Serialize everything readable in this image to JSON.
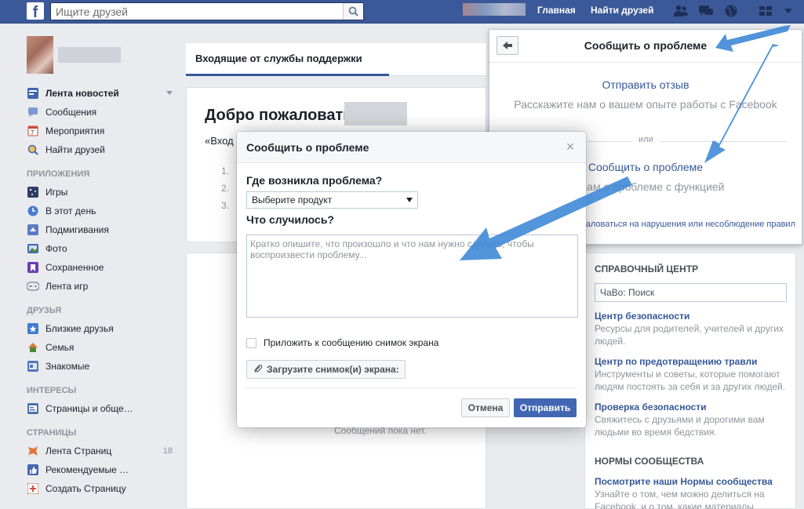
{
  "topbar": {
    "logo": "f",
    "search_placeholder": "Ищите друзей",
    "nav_home": "Главная",
    "nav_find_friends": "Найти друзей"
  },
  "sidebar": {
    "items_top": [
      {
        "label": "Лента новостей",
        "icon": "news-feed-icon"
      },
      {
        "label": "Сообщения",
        "icon": "messages-icon"
      },
      {
        "label": "Мероприятия",
        "icon": "events-icon"
      },
      {
        "label": "Найти друзей",
        "icon": "find-friends-icon"
      }
    ],
    "heading_apps": "ПРИЛОЖЕНИЯ",
    "items_apps": [
      {
        "label": "Игры",
        "icon": "games-icon"
      },
      {
        "label": "В этот день",
        "icon": "on-this-day-icon"
      },
      {
        "label": "Подмигивания",
        "icon": "pokes-icon"
      },
      {
        "label": "Фото",
        "icon": "photos-icon"
      },
      {
        "label": "Сохраненное",
        "icon": "saved-icon"
      },
      {
        "label": "Лента игр",
        "icon": "games-feed-icon"
      }
    ],
    "heading_friends": "ДРУЗЬЯ",
    "items_friends": [
      {
        "label": "Близкие друзья",
        "icon": "close-friends-icon"
      },
      {
        "label": "Семья",
        "icon": "family-icon"
      },
      {
        "label": "Знакомые",
        "icon": "acquaintances-icon"
      }
    ],
    "heading_interests": "ИНТЕРЕСЫ",
    "items_interests": [
      {
        "label": "Страницы и обще…",
        "icon": "pages-icon"
      }
    ],
    "heading_pages": "СТРАНИЦЫ",
    "items_pages": [
      {
        "label": "Лента Страниц",
        "icon": "pages-feed-icon",
        "count": "18"
      },
      {
        "label": "Рекомендуемые …",
        "icon": "like-icon"
      },
      {
        "label": "Создать Страницу",
        "icon": "create-page-icon"
      }
    ]
  },
  "main": {
    "tab_label": "Входящие от службы поддержки",
    "welcome_title": "Добро пожаловать,",
    "welcome_quote": "«Вход",
    "welcome_numbers": [
      "1.",
      "2.",
      "3."
    ],
    "no_messages": "Сообщений пока нет."
  },
  "help": {
    "heading": "СПРАВОЧНЫЙ ЦЕНТР",
    "search_placeholder": "ЧаВо: Поиск",
    "links": [
      {
        "title": "Центр безопасности",
        "desc": "Ресурсы для родителей, учителей и других людей."
      },
      {
        "title": "Центр по предотвращению травли",
        "desc": "Инструменты и советы, которые помогают людям постоять за себя и за других людей."
      },
      {
        "title": "Проверка безопасности",
        "desc": "Свяжитесь с друзьями и дорогими вам людьми во время бедствия."
      }
    ],
    "heading_norms": "НОРМЫ СООБЩЕСТВА",
    "norms_link": "Посмотрите наши Нормы сообщества",
    "norms_desc": "Узнайте о том, чем можно делиться на Facebook, и о том, какие материалы"
  },
  "report_panel": {
    "title": "Сообщить о проблеме",
    "feedback_link": "Отправить отзыв",
    "feedback_desc": "Расскажите нам о вашем опыте работы с Facebook",
    "or": "или",
    "report_link": "Сообщить о проблеме",
    "report_desc": "те нам о проблеме с функцией",
    "bottom_link": "аловаться на нарушения или несоблюдение правил"
  },
  "modal": {
    "title": "Сообщить о проблеме",
    "close": "×",
    "where_label": "Где возникла проблема?",
    "select_value": "Выберите продукт",
    "what_label": "Что случилось?",
    "textarea_placeholder": "Кратко опишите, что произошло и что нам нужно сделать, чтобы воспроизвести проблему...",
    "attach_label": "Приложить к сообщению снимок экрана",
    "upload_label": "Загрузите снимок(и) экрана:",
    "cancel_label": "Отмена",
    "send_label": "Отправить"
  },
  "colors": {
    "brand": "#3b5998",
    "primary_button": "#4267b2",
    "link": "#365899",
    "annotation_arrow": "#3a86d6"
  }
}
